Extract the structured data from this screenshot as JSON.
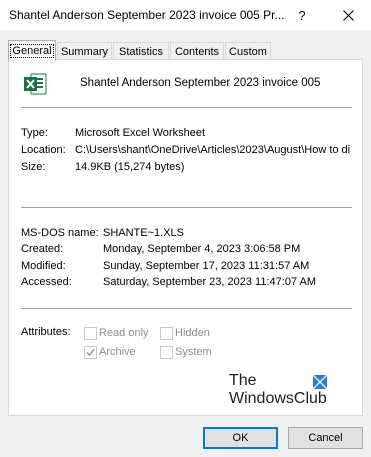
{
  "window": {
    "title": "Shantel Anderson September 2023 invoice 005 Pr...",
    "help_label": "?",
    "close_label": "✕"
  },
  "tabs": [
    {
      "label": "General"
    },
    {
      "label": "Summary"
    },
    {
      "label": "Statistics"
    },
    {
      "label": "Contents"
    },
    {
      "label": "Custom"
    }
  ],
  "file": {
    "name": "Shantel Anderson September 2023 invoice 005",
    "icon": "excel-icon"
  },
  "info": {
    "type_label": "Type:",
    "type_value": "Microsoft Excel Worksheet",
    "location_label": "Location:",
    "location_value": "C:\\Users\\shant\\OneDrive\\Articles\\2023\\August\\How to di",
    "size_label": "Size:",
    "size_value": "14.9KB (15,274 bytes)"
  },
  "dates": {
    "msdos_label": "MS-DOS name:",
    "msdos_value": "SHANTE~1.XLS",
    "created_label": "Created:",
    "created_value": "Monday, September 4, 2023 3:06:58 PM",
    "modified_label": "Modified:",
    "modified_value": "Sunday, September 17, 2023 11:31:57 AM",
    "accessed_label": "Accessed:",
    "accessed_value": "Saturday, September 23, 2023 11:47:07 AM"
  },
  "attributes": {
    "label": "Attributes:",
    "read_only": {
      "label": "Read only",
      "checked": false
    },
    "hidden": {
      "label": "Hidden",
      "checked": false
    },
    "archive": {
      "label": "Archive",
      "checked": true
    },
    "system": {
      "label": "System",
      "checked": false
    }
  },
  "watermark": {
    "line1": "The",
    "line2": "WindowsClub"
  },
  "buttons": {
    "ok": "OK",
    "cancel": "Cancel"
  },
  "colors": {
    "excel_green": "#1e7145",
    "accent": "#0078d7"
  }
}
